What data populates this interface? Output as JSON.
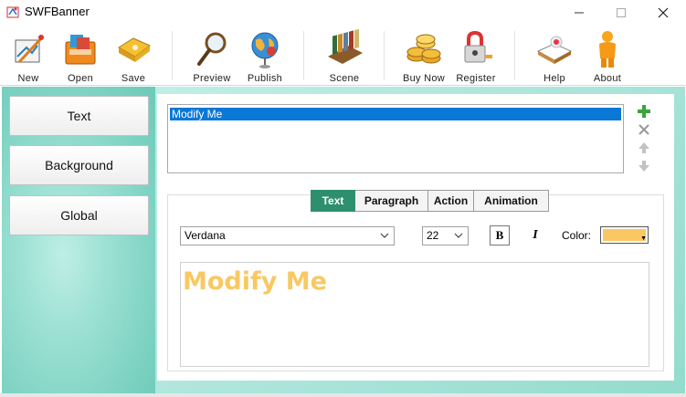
{
  "window": {
    "title": "SWFBanner",
    "controls": {
      "minimize": "minimize",
      "maximize": "maximize",
      "close": "close"
    }
  },
  "toolbar": {
    "items": [
      {
        "label": "New",
        "icon": "new-icon"
      },
      {
        "label": "Open",
        "icon": "open-folder-icon"
      },
      {
        "label": "Save",
        "icon": "save-disk-icon"
      },
      {
        "label": "Preview",
        "icon": "magnifier-icon"
      },
      {
        "label": "Publish",
        "icon": "globe-icon"
      },
      {
        "label": "Scene",
        "icon": "books-icon"
      },
      {
        "label": "Buy Now",
        "icon": "coins-icon"
      },
      {
        "label": "Register",
        "icon": "lock-icon"
      },
      {
        "label": "Help",
        "icon": "help-book-icon"
      },
      {
        "label": "About",
        "icon": "person-icon"
      }
    ]
  },
  "sidebar": {
    "items": [
      {
        "label": "Text"
      },
      {
        "label": "Background"
      },
      {
        "label": "Global"
      }
    ]
  },
  "text_list": {
    "items": [
      "Modify Me"
    ],
    "selected": 0
  },
  "list_actions": {
    "add": "plus-icon",
    "delete": "cross-icon",
    "up": "arrow-up-icon",
    "down": "arrow-down-icon"
  },
  "tabs": [
    {
      "label": "Text",
      "active": true
    },
    {
      "label": "Paragraph",
      "active": false
    },
    {
      "label": "Action",
      "active": false
    },
    {
      "label": "Animation",
      "active": false
    }
  ],
  "text_props": {
    "font": "Verdana",
    "size": "22",
    "bold_label": "B",
    "italic_label": "I",
    "color_label": "Color:",
    "color_value": "#f9c863",
    "content": "Modify Me"
  },
  "colors": {
    "accent": "#2e8f6e",
    "selection": "#0a78d7",
    "panel_bg": "#9be0d3"
  }
}
